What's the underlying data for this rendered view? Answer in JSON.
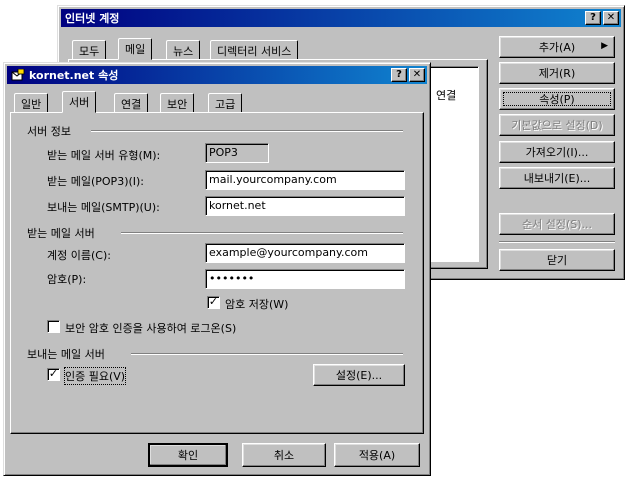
{
  "back_window": {
    "title": "인터넷 계정",
    "tabs": [
      "모두",
      "메일",
      "뉴스",
      "디렉터리 서비스"
    ],
    "list_fragment": "연결",
    "buttons": {
      "add": "추가(A)",
      "remove": "제거(R)",
      "properties": "속성(P)",
      "set_default": "기본값으로 설정(D)",
      "import": "가져오기(I)...",
      "export": "내보내기(E)...",
      "set_order": "순서 설정(S)...",
      "close": "닫기"
    }
  },
  "dialog": {
    "title": "kornet.net 속성",
    "tabs": [
      "일반",
      "서버",
      "연결",
      "보안",
      "고급"
    ],
    "active_tab": "서버",
    "server_info": {
      "heading": "서버 정보",
      "incoming_type_label": "받는 메일 서버 유형(M):",
      "incoming_type_value": "POP3",
      "incoming_label": "받는 메일(POP3)(I):",
      "incoming_value": "mail.yourcompany.com",
      "outgoing_label": "보내는 메일(SMTP)(U):",
      "outgoing_value": "kornet.net"
    },
    "incoming_server": {
      "heading": "받는 메일 서버",
      "account_label": "계정 이름(C):",
      "account_value": "example@yourcompany.com",
      "password_label": "암호(P):",
      "password_value": "•••••••",
      "remember_password_label": "암호 저장(W)",
      "remember_password_checked": true,
      "spa_label": "보안 암호 인증을 사용하여 로그온(S)",
      "spa_checked": false
    },
    "outgoing_server": {
      "heading": "보내는 메일 서버",
      "auth_label": "인증 필요(V)",
      "auth_checked": true,
      "settings_button": "설정(E)..."
    },
    "buttons": {
      "ok": "확인",
      "cancel": "취소",
      "apply": "적용(A)"
    },
    "title_buttons": {
      "help": "?",
      "close": "✕"
    }
  }
}
